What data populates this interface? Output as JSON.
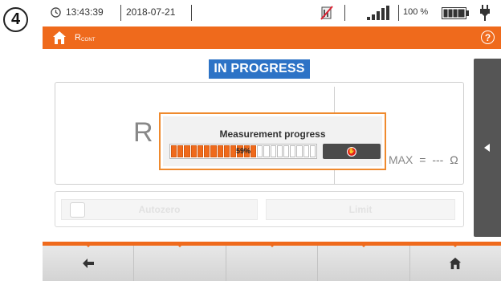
{
  "step_badge": "4",
  "status": {
    "time": "13:43:39",
    "date": "2018-07-21",
    "battery_percent": "100 %"
  },
  "titlebar": {
    "title_main": "R",
    "title_sub": "CONT",
    "help_label": "?"
  },
  "status_chip": "IN PROGRESS",
  "measurement": {
    "big_symbol": "R",
    "rmax_label": "MAX",
    "rmax_eq": "=",
    "rmax_value": "---",
    "rmax_unit": "Ω"
  },
  "progress_dialog": {
    "title": "Measurement progress",
    "percent_text": "59%",
    "percent_value": 59
  },
  "options": {
    "autozero_label": "Autozero",
    "limit_label": "Limit"
  },
  "colors": {
    "accent": "#ef6a1c",
    "status_chip": "#2d73c6",
    "stop": "#e2231a"
  },
  "icons": {
    "clock": "clock-icon",
    "no_signal": "no-signal-icon",
    "signal": "signal-strength-icon",
    "battery": "battery-icon",
    "plug": "plug-icon",
    "home": "home-icon",
    "back": "back-arrow-icon",
    "stop": "stop-hand-icon",
    "side": "chevron-left-icon"
  }
}
